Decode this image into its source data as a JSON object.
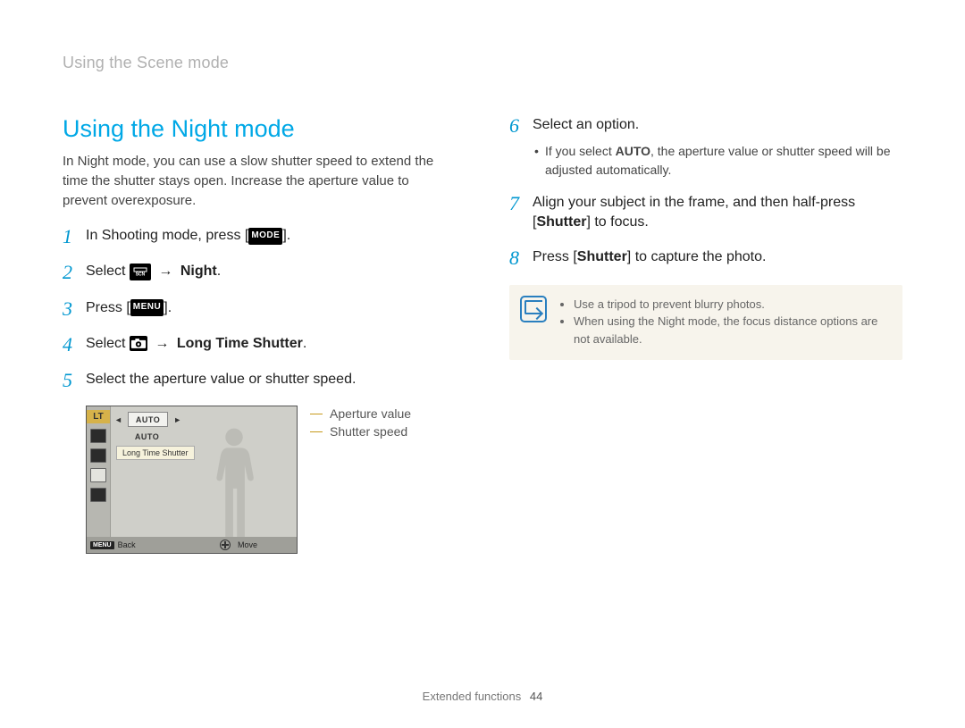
{
  "header": {
    "running_head": "Using the Scene mode"
  },
  "section": {
    "title": "Using the Night mode",
    "intro": "In Night mode, you can use a slow shutter speed to extend the time the shutter stays open. Increase the aperture value to prevent overexposure."
  },
  "steps": {
    "s1": {
      "num": "1",
      "text_a": "In Shooting mode, press [",
      "icon": "MODE",
      "text_b": "]."
    },
    "s2": {
      "num": "2",
      "text_a": "Select ",
      "icon": "SCN",
      "arrow": "→",
      "bold": "Night",
      "text_b": "."
    },
    "s3": {
      "num": "3",
      "text_a": "Press [",
      "icon": "MENU",
      "text_b": "]."
    },
    "s4": {
      "num": "4",
      "text_a": "Select ",
      "arrow": "→",
      "bold": "Long Time Shutter",
      "text_b": "."
    },
    "s5": {
      "num": "5",
      "text": "Select the aperture value or shutter speed."
    },
    "s6": {
      "num": "6",
      "text": "Select an option.",
      "bullet_a": "If you select ",
      "bullet_bold": "AUTO",
      "bullet_b": ", the aperture value or shutter speed will be adjusted automatically."
    },
    "s7": {
      "num": "7",
      "text_a": "Align your subject in the frame, and then half-press [",
      "bold": "Shutter",
      "text_b": "] to focus."
    },
    "s8": {
      "num": "8",
      "text_a": "Press [",
      "bold": "Shutter",
      "text_b": "] to capture the photo."
    }
  },
  "lcd": {
    "lt": "LT",
    "auto1": "AUTO",
    "auto2": "AUTO",
    "tooltip": "Long Time Shutter",
    "back": "Back",
    "move": "Move"
  },
  "lcd_labels": {
    "ap": "Aperture value",
    "ss": "Shutter speed"
  },
  "note": {
    "n1": "Use a tripod to prevent blurry photos.",
    "n2": "When using the Night mode, the focus distance options are not available."
  },
  "footer": {
    "section": "Extended functions",
    "page": "44"
  }
}
